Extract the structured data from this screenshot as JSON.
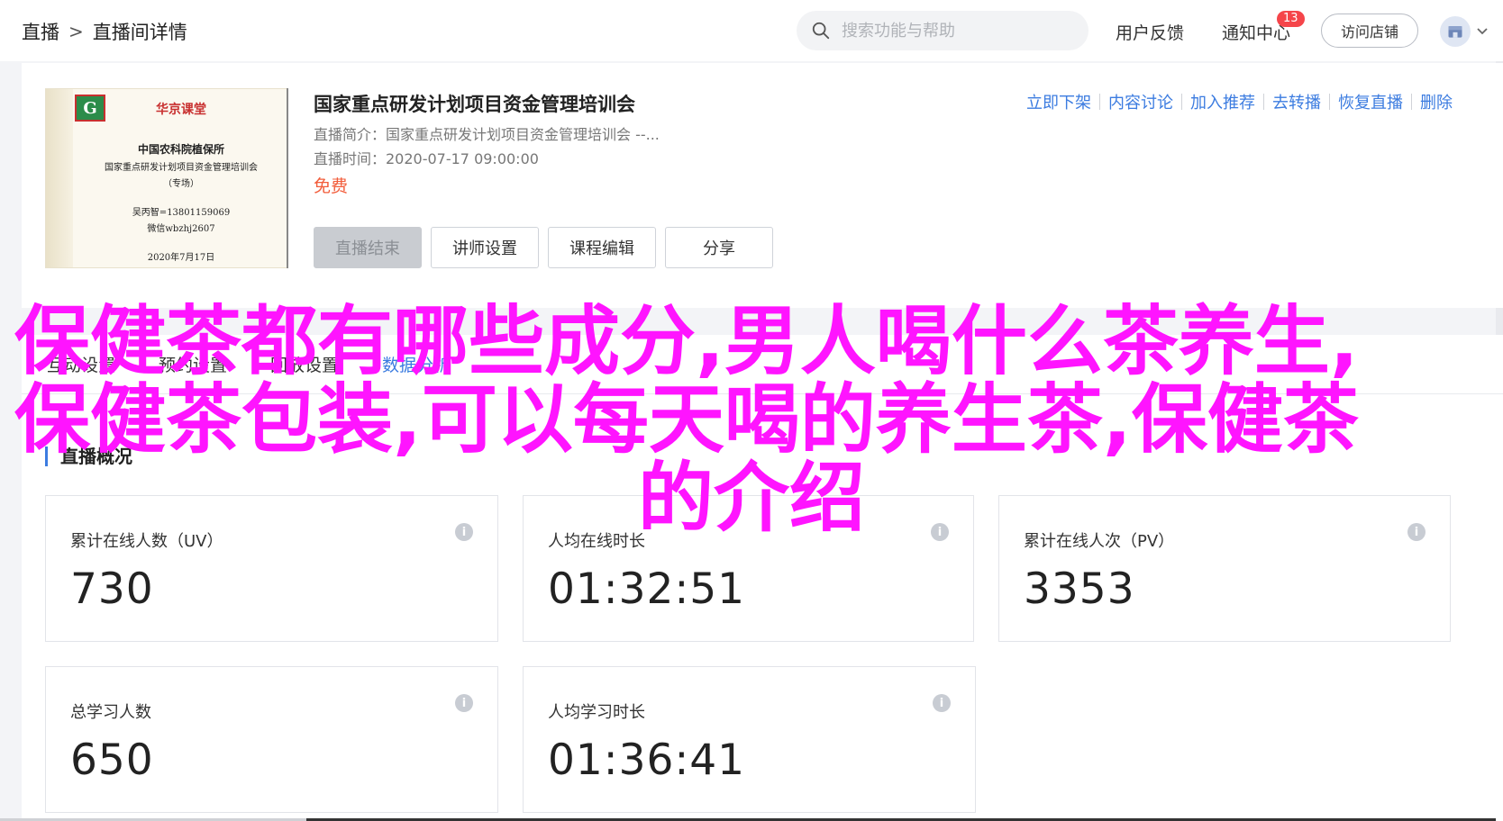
{
  "header": {
    "breadcrumb": [
      "直播",
      ">",
      "直播间详情"
    ],
    "search_placeholder": "搜索功能与帮助",
    "feedback": "用户反馈",
    "notice": "通知中心",
    "notice_count": "13",
    "visit_store": "访问店铺"
  },
  "live": {
    "cover": {
      "brand": "华京课堂",
      "logo_letter": "G",
      "org": "中国农科院植保所",
      "course": "国家重点研发计划项目资金管理培训会",
      "tag": "（专场）",
      "contact": "吴丙智=13801159069",
      "wechat": "微信wbzhj2607",
      "date": "2020年7月17日"
    },
    "title": "国家重点研发计划项目资金管理培训会",
    "intro": "直播简介：国家重点研发计划项目资金管理培训会 --...",
    "time": "直播时间：2020-07-17 09:00:00",
    "price": "免费",
    "ops": [
      "立即下架",
      "内容讨论",
      "加入推荐",
      "去转播",
      "恢复直播",
      "删除"
    ],
    "buttons": [
      "直播结束",
      "讲师设置",
      "课程编辑",
      "分享"
    ]
  },
  "data_section": {
    "tabs": [
      "互动设置",
      "预约设置",
      "回放设置",
      "数据分析"
    ],
    "active_tab": 3,
    "overview_title": "直播概况",
    "stats": [
      {
        "label": "累计在线人数（UV）",
        "value": "730"
      },
      {
        "label": "人均在线时长",
        "value": "01:32:51"
      },
      {
        "label": "累计在线人次（PV）",
        "value": "3353"
      },
      {
        "label": "总学习人数",
        "value": "650"
      },
      {
        "label": "人均学习时长",
        "value": "01:36:41"
      }
    ],
    "info_symbol": "i"
  },
  "overlay": {
    "line1": "保健茶都有哪些成分,男人喝什么茶养生,",
    "line2": "保健茶包装,可以每天喝的养生茶,保健茶",
    "line3": "的介绍"
  },
  "colors": {
    "accent": "#3c7ce0",
    "overlay": "#ff14ff",
    "price": "#f25c3a",
    "badge": "#f5454a"
  },
  "icons": [
    "search-icon",
    "store-icon",
    "chevron-down-icon",
    "info-icon"
  ]
}
